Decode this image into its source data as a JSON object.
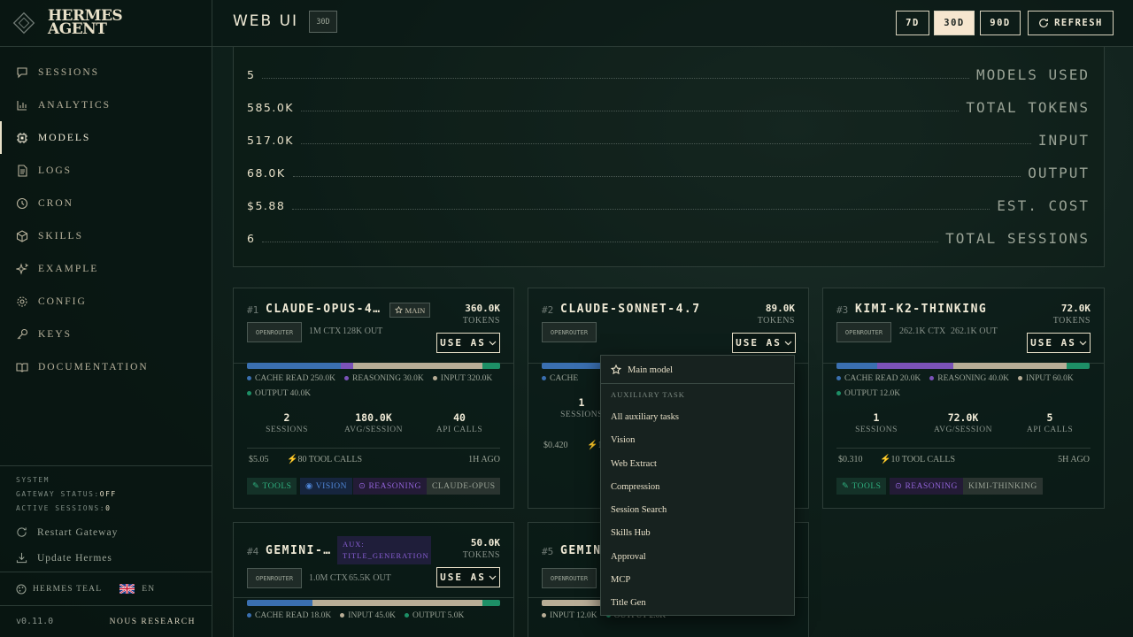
{
  "sidebar": {
    "brand": {
      "line1": "HERMES",
      "line2": "AGENT"
    },
    "items": [
      {
        "label": "SESSIONS",
        "icon": "chat-icon"
      },
      {
        "label": "ANALYTICS",
        "icon": "bar-chart-icon"
      },
      {
        "label": "MODELS",
        "icon": "chip-icon",
        "active": true
      },
      {
        "label": "LOGS",
        "icon": "file-icon"
      },
      {
        "label": "CRON",
        "icon": "clock-icon"
      },
      {
        "label": "SKILLS",
        "icon": "package-icon"
      },
      {
        "label": "EXAMPLE",
        "icon": "sparkle-icon"
      },
      {
        "label": "CONFIG",
        "icon": "gear-icon"
      },
      {
        "label": "KEYS",
        "icon": "key-icon"
      },
      {
        "label": "DOCUMENTATION",
        "icon": "book-icon"
      }
    ],
    "system": {
      "title": "SYSTEM",
      "gateway_label": "GATEWAY STATUS:",
      "gateway_value": "OFF",
      "sessions_label": "ACTIVE SESSIONS:",
      "sessions_value": "0"
    },
    "restart": "Restart Gateway",
    "update": "Update Hermes",
    "theme": "HERMES TEAL",
    "lang": "EN",
    "version": "v0.11.0",
    "org": "NOUS RESEARCH"
  },
  "header": {
    "title": "WEB UI",
    "badge": "30D",
    "ranges": [
      "7D",
      "30D",
      "90D"
    ],
    "active_range": "30D",
    "refresh": "REFRESH"
  },
  "stats": [
    {
      "value": "5",
      "label": "MODELS USED"
    },
    {
      "value": "585.0K",
      "label": "TOTAL TOKENS"
    },
    {
      "value": "517.0K",
      "label": "INPUT"
    },
    {
      "value": "68.0K",
      "label": "OUTPUT"
    },
    {
      "value": "$5.88",
      "label": "EST. COST"
    },
    {
      "value": "6",
      "label": "TOTAL SESSIONS"
    }
  ],
  "cards": [
    {
      "rank": "#1",
      "name": "CLAUDE-OPUS-4...",
      "tag": "MAIN",
      "tokens": "360.0K",
      "tokens_label": "TOKENS",
      "provider": "OPENROUTER",
      "ctx": "1M CTX",
      "out": "128K OUT",
      "use_as": "USE AS",
      "legend": [
        "CACHE READ 250.0K",
        "REASONING 30.0K",
        "INPUT 320.0K",
        "OUTPUT 40.0K"
      ],
      "sessions": "2",
      "sessions_label": "SESSIONS",
      "avg": "180.0K",
      "avg_label": "AVG/SESSION",
      "calls": "40",
      "calls_label": "API CALLS",
      "cost": "$5.05",
      "tool_calls": "80 TOOL CALLS",
      "ago": "1H AGO",
      "tags": [
        "TOOLS",
        "VISION",
        "REASONING",
        "CLAUDE-OPUS"
      ]
    },
    {
      "rank": "#2",
      "name": "CLAUDE-SONNET-4.7",
      "tokens": "89.0K",
      "tokens_label": "TOKENS",
      "provider": "OPENROUTER",
      "use_as": "USE AS",
      "legend": [
        "CACHE"
      ],
      "sessions": "1",
      "sessions_label": "SESSIONS",
      "cost": "$0.420",
      "tool_calls": "1"
    },
    {
      "rank": "#3",
      "name": "KIMI-K2-THINKING",
      "tokens": "72.0K",
      "tokens_label": "TOKENS",
      "provider": "OPENROUTER",
      "ctx": "262.1K CTX",
      "out": "262.1K OUT",
      "use_as": "USE AS",
      "legend": [
        "CACHE READ 20.0K",
        "REASONING 40.0K",
        "INPUT 60.0K",
        "OUTPUT 12.0K"
      ],
      "sessions": "1",
      "sessions_label": "SESSIONS",
      "avg": "72.0K",
      "avg_label": "AVG/SESSION",
      "calls": "5",
      "calls_label": "API CALLS",
      "cost": "$0.310",
      "tool_calls": "10 TOOL CALLS",
      "ago": "5H AGO",
      "tags": [
        "TOOLS",
        "REASONING",
        "KIMI-THINKING"
      ]
    },
    {
      "rank": "#4",
      "name": "GEMINI-...",
      "tag": "AUX: TITLE_GENERATION",
      "tokens": "50.0K",
      "tokens_label": "TOKENS",
      "provider": "OPENROUTER",
      "ctx": "1.0M CTX",
      "out": "65.5K OUT",
      "use_as": "USE AS",
      "legend": [
        "CACHE READ 18.0K",
        "INPUT 45.0K",
        "OUTPUT 5.0K"
      ]
    },
    {
      "rank": "#5",
      "name": "GEMIN",
      "provider": "OPENROUTER",
      "legend": [
        "INPUT 12.0K",
        "OUTPUT 2.0K"
      ]
    }
  ],
  "dropdown": {
    "main": "Main model",
    "section": "AUXILIARY TASK",
    "items": [
      "All auxiliary tasks",
      "Vision",
      "Web Extract",
      "Compression",
      "Session Search",
      "Skills Hub",
      "Approval",
      "MCP",
      "Title Gen"
    ]
  },
  "colors": {
    "cache": "#3a6fb0",
    "reasoning": "#7b52b8",
    "input": "#b8ad96",
    "output": "#1d8f66"
  }
}
